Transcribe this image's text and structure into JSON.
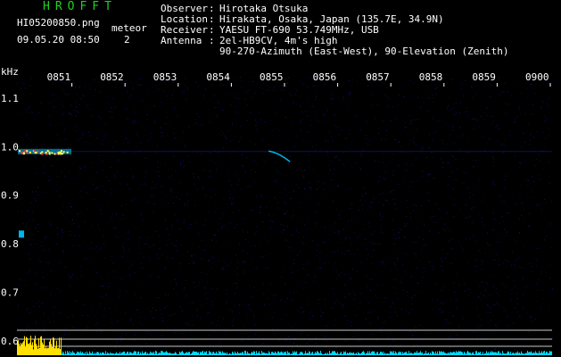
{
  "header": {
    "brand": "HROFFT",
    "filename": "HI05200850.png",
    "datetime": "09.05.20 08:50",
    "meteor_label": "meteor",
    "meteor_count": "2",
    "info": [
      {
        "key": "Observer",
        "value": "Hirotaka Otsuka"
      },
      {
        "key": "Location",
        "value": "Hirakata, Osaka, Japan (135.7E, 34.9N)"
      },
      {
        "key": "Receiver",
        "value": "YAESU FT-690 53.749MHz, USB"
      },
      {
        "key": "Antenna",
        "value": "2el-HB9CV, 4m's high"
      },
      {
        "key": "",
        "value": "90-270-Azimuth (East-West), 90-Elevation (Zenith)"
      }
    ]
  },
  "chart_data": {
    "type": "heatmap",
    "ylabel": "kHz",
    "x_ticks": [
      "0851",
      "0852",
      "0853",
      "0854",
      "0855",
      "0856",
      "0857",
      "0858",
      "0859",
      "0900"
    ],
    "xlim": [
      "0850",
      "0900"
    ],
    "y_ticks": [
      "1.1",
      "1.0",
      "0.9",
      "0.8",
      "0.7",
      "0.6"
    ],
    "ylim": [
      0.6,
      1.12
    ],
    "carrier_frequency": 0.99,
    "meteor_echoes": [
      {
        "time": "0850",
        "frequency": 0.99
      },
      {
        "time": "0855",
        "frequency": 0.98
      }
    ],
    "colors": {
      "background": "#000010",
      "noise": "#1a1aa0",
      "echo": "#00c8ff",
      "strong_echo": "#ff3030",
      "axis_text": "#ffffff",
      "level_bars": "#ffe000",
      "level_noise": "#00d8ff"
    }
  }
}
